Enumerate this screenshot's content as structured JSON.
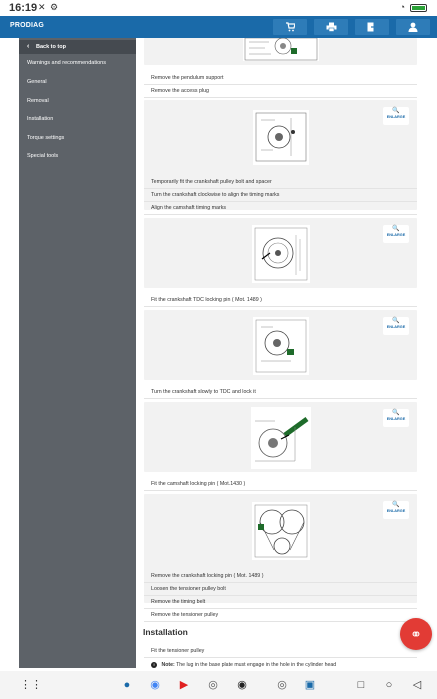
{
  "status_bar": {
    "time": "16:19"
  },
  "app": {
    "title": "PRODIAG"
  },
  "toolbar": {
    "cart_icon": "cart-icon",
    "print_icon": "print-icon",
    "export_icon": "export-icon",
    "user_icon": "user-icon"
  },
  "sidebar": {
    "back_label": "Back to top",
    "items": [
      {
        "label": "Warnings and recommendations"
      },
      {
        "label": "General"
      },
      {
        "label": "Removal"
      },
      {
        "label": "Installation"
      },
      {
        "label": "Torque settings"
      },
      {
        "label": "Special tools"
      }
    ]
  },
  "content": {
    "enlarge_label": "ENLARGE",
    "steps": [
      "Remove the pendulum support",
      "Remove the access plug",
      "Temporarily fit the crankshaft pulley bolt and spacer",
      "Turn the crankshaft clockwise to align the timing marks",
      "Align the camshaft timing marks",
      "Fit the crankshaft TDC locking pin ( Mot. 1489 )",
      "Turn the crankshaft slowly to TDC and lock it",
      "Fit the camshaft locking pin ( Mot.1430 )",
      "Remove the crankshaft locking pin ( Mot. 1489 )",
      "Loosen the tensioner pulley bolt",
      "Remove the timing belt",
      "Remove the tensioner pulley"
    ],
    "section_title": "Installation",
    "install_step": "Fit the tensioner pulley",
    "note_label": "Note:",
    "note_text": "The lug in the base plate must engage in the hole in the cylinder head"
  }
}
